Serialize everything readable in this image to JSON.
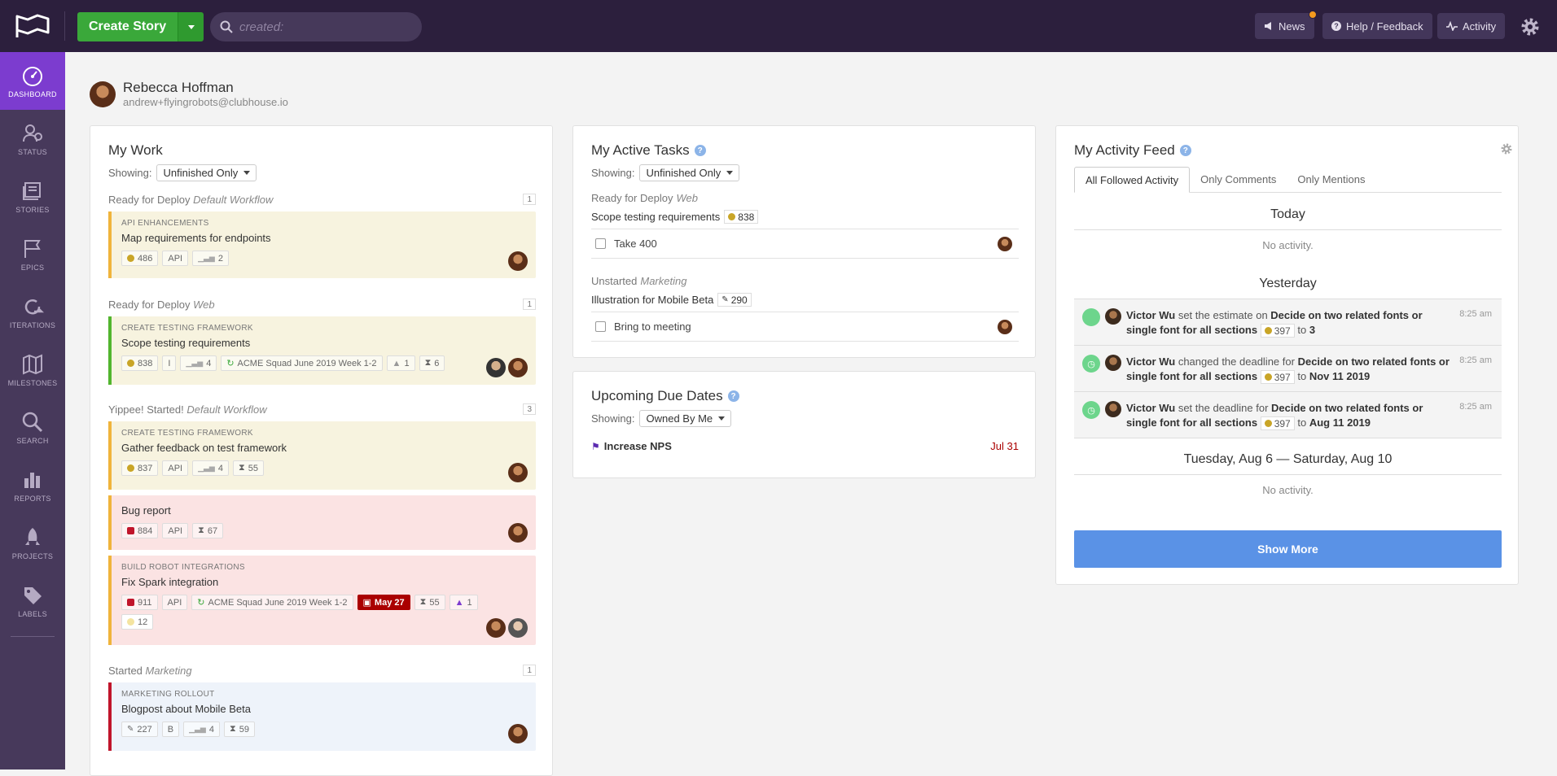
{
  "topbar": {
    "create_label": "Create Story",
    "search_placeholder": "created:",
    "news_label": "News",
    "help_label": "Help / Feedback",
    "activity_label": "Activity",
    "news_dot_color": "#f39a1e"
  },
  "sidebar": {
    "items": [
      {
        "label": "DASHBOARD",
        "icon": "dashboard-icon"
      },
      {
        "label": "STATUS",
        "icon": "status-icon"
      },
      {
        "label": "STORIES",
        "icon": "stories-icon"
      },
      {
        "label": "EPICS",
        "icon": "epics-icon"
      },
      {
        "label": "ITERATIONS",
        "icon": "iterations-icon"
      },
      {
        "label": "MILESTONES",
        "icon": "milestones-icon"
      },
      {
        "label": "SEARCH",
        "icon": "search-icon"
      },
      {
        "label": "REPORTS",
        "icon": "reports-icon"
      },
      {
        "label": "PROJECTS",
        "icon": "projects-icon"
      },
      {
        "label": "LABELS",
        "icon": "labels-icon"
      }
    ]
  },
  "profile": {
    "name": "Rebecca Hoffman",
    "email": "andrew+flyingrobots@clubhouse.io"
  },
  "my_work": {
    "title": "My Work",
    "showing_label": "Showing:",
    "filter": "Unfinished Only",
    "groups": [
      {
        "state": "Ready for Deploy",
        "workflow": "Default Workflow",
        "count": "1",
        "cards": [
          {
            "epic": "API ENHANCEMENTS",
            "title": "Map requirements for endpoints",
            "id": "486",
            "project": "API",
            "estimate": "2"
          }
        ]
      },
      {
        "state": "Ready for Deploy",
        "workflow": "Web",
        "count": "1",
        "cards": [
          {
            "epic": "CREATE TESTING FRAMEWORK",
            "title": "Scope testing requirements",
            "id": "838",
            "label": "I",
            "estimate": "4",
            "iteration": "ACME Squad June 2019 Week 1-2",
            "warn": "1",
            "tasks": "6"
          }
        ]
      },
      {
        "state": "Yippee! Started!",
        "workflow": "Default Workflow",
        "count": "3",
        "cards": [
          {
            "epic": "CREATE TESTING FRAMEWORK",
            "title": "Gather feedback on test framework",
            "id": "837",
            "project": "API",
            "estimate": "4",
            "tasks": "55"
          },
          {
            "title": "Bug report",
            "id": "884",
            "project": "API",
            "tasks": "67"
          },
          {
            "epic": "BUILD ROBOT INTEGRATIONS",
            "title": "Fix Spark integration",
            "id": "911",
            "project": "API",
            "iteration": "ACME Squad June 2019 Week 1-2",
            "due": "May 27",
            "tasks": "55",
            "warn": "1",
            "extra": "12"
          }
        ]
      },
      {
        "state": "Started",
        "workflow": "Marketing",
        "count": "1",
        "cards": [
          {
            "epic": "MARKETING ROLLOUT",
            "title": "Blogpost about Mobile Beta",
            "id": "227",
            "label": "B",
            "estimate": "4",
            "tasks": "59"
          }
        ]
      }
    ]
  },
  "active_tasks": {
    "title": "My Active Tasks",
    "showing_label": "Showing:",
    "filter": "Unfinished Only",
    "groups": [
      {
        "state": "Ready for Deploy",
        "workflow": "Web",
        "story": "Scope testing requirements",
        "id": "838",
        "task": "Take 400"
      },
      {
        "state": "Unstarted",
        "workflow": "Marketing",
        "story": "Illustration for Mobile Beta",
        "id": "290",
        "task": "Bring to meeting"
      }
    ]
  },
  "due_dates": {
    "title": "Upcoming Due Dates",
    "showing_label": "Showing:",
    "filter": "Owned By Me",
    "items": [
      {
        "name": "Increase NPS",
        "date": "Jul 31"
      }
    ]
  },
  "activity_feed": {
    "title": "My Activity Feed",
    "tabs": [
      "All Followed Activity",
      "Only Comments",
      "Only Mentions"
    ],
    "today": "Today",
    "no_activity": "No activity.",
    "yesterday": "Yesterday",
    "range": "Tuesday, Aug 6 — Saturday, Aug 10",
    "entries": [
      {
        "who": "Victor Wu",
        "verb": "set the estimate on",
        "story": "Decide on two related fonts or single font for all sections",
        "id": "397",
        "to": "to",
        "value": "3",
        "time": "8:25 am"
      },
      {
        "who": "Victor Wu",
        "verb": "changed the deadline for",
        "story": "Decide on two related fonts or single font for all sections",
        "id": "397",
        "to": "to",
        "value": "Nov 11 2019",
        "time": "8:25 am"
      },
      {
        "who": "Victor Wu",
        "verb": "set the deadline for",
        "story": "Decide on two related fonts or single font for all sections",
        "id": "397",
        "to": "to",
        "value": "Aug 11 2019",
        "time": "8:25 am"
      }
    ],
    "show_more": "Show More"
  }
}
